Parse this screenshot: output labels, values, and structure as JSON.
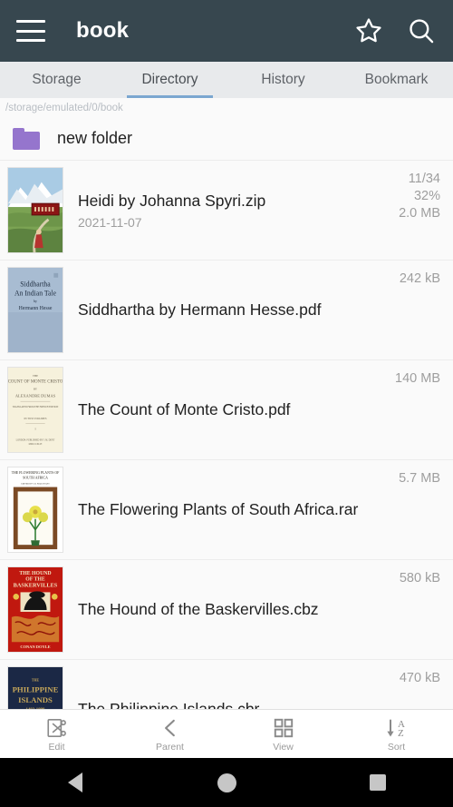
{
  "header": {
    "title": "book",
    "menu_icon": "hamburger-menu-icon",
    "star_icon": "star-outline-icon",
    "search_icon": "search-icon"
  },
  "tabs": [
    {
      "label": "Storage",
      "active": false
    },
    {
      "label": "Directory",
      "active": true
    },
    {
      "label": "History",
      "active": false
    },
    {
      "label": "Bookmark",
      "active": false
    }
  ],
  "path": "/storage/emulated/0/book",
  "folders": [
    {
      "name": "new folder",
      "icon": "folder-icon",
      "color": "#9575cd"
    }
  ],
  "files": [
    {
      "name": "Heidi by Johanna Spyri.zip",
      "date": "2021-11-07",
      "progress": "11/34",
      "percent": "32%",
      "size": "2.0 MB",
      "cover": "heidi"
    },
    {
      "name": "Siddhartha by Hermann Hesse.pdf",
      "date": "",
      "progress": "",
      "percent": "",
      "size": "242 kB",
      "cover": "siddhartha"
    },
    {
      "name": "The Count of Monte Cristo.pdf",
      "date": "",
      "progress": "",
      "percent": "",
      "size": "140 MB",
      "cover": "montecristo"
    },
    {
      "name": "The Flowering Plants of South Africa.rar",
      "date": "",
      "progress": "",
      "percent": "",
      "size": "5.7 MB",
      "cover": "flowering"
    },
    {
      "name": "The Hound of the Baskervilles.cbz",
      "date": "",
      "progress": "",
      "percent": "",
      "size": "580 kB",
      "cover": "hound"
    },
    {
      "name": "The Philippine Islands.cbr",
      "date": "",
      "progress": "",
      "percent": "",
      "size": "470 kB",
      "cover": "philippine"
    }
  ],
  "toolbar": [
    {
      "label": "Edit",
      "icon": "cut-scissors-icon"
    },
    {
      "label": "Parent",
      "icon": "chevron-left-icon"
    },
    {
      "label": "View",
      "icon": "grid-view-icon"
    },
    {
      "label": "Sort",
      "icon": "sort-az-icon"
    }
  ],
  "navbar": [
    {
      "icon": "back-triangle-icon"
    },
    {
      "icon": "home-circle-icon"
    },
    {
      "icon": "recents-square-icon"
    }
  ],
  "colors": {
    "appbar": "#37474f",
    "tab_indicator": "#7ba7d0",
    "folder": "#9575cd",
    "background": "#fafafa"
  }
}
